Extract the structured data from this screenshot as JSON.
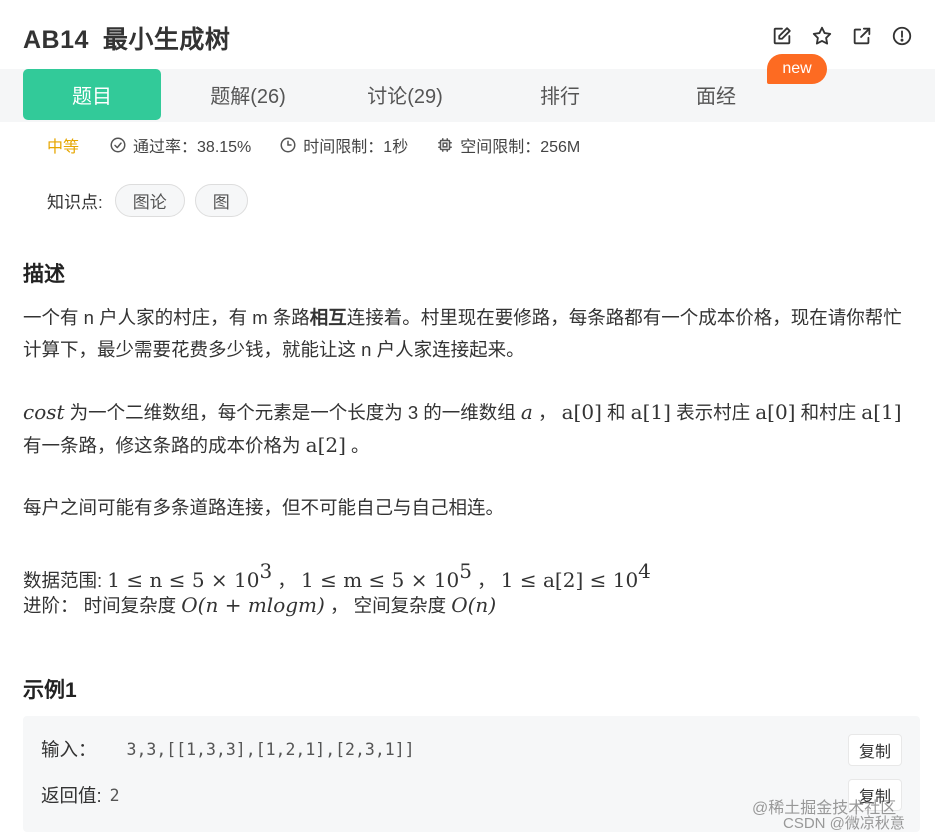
{
  "problem": {
    "code": "AB14",
    "name": "最小生成树"
  },
  "icons": [
    "edit-icon",
    "star-icon",
    "share-icon",
    "report-icon"
  ],
  "tabs": [
    {
      "label": "题目",
      "active": true
    },
    {
      "label": "题解(26)",
      "active": false
    },
    {
      "label": "讨论(29)",
      "active": false
    },
    {
      "label": "排行",
      "active": false
    },
    {
      "label": "面经",
      "active": false
    }
  ],
  "new_badge": "new",
  "meta": {
    "difficulty": "中等",
    "pass_rate": "通过率：38.15%",
    "time_limit": "时间限制：1秒",
    "memory_limit": "空间限制：256M"
  },
  "knowledge": {
    "label": "知识点:",
    "tags": [
      "图论",
      "图"
    ]
  },
  "description": {
    "heading": "描述",
    "p1_a": "一个有 n 户人家的村庄，有 m 条路",
    "p1_bold": "相互",
    "p1_b": "连接着。村里现在要修路，每条路都有一个成本价格，现在请你帮忙计算下，最少需要花费多少钱，就能让这 n 户人家连接起来。",
    "p2_cost": "cost",
    "p2_t1": " 为一个二维数组，每个元素是一个长度为 3 的一维数组 ",
    "p2_a": "a",
    "p2_t2": " ，  ",
    "p2_a0": "a[0]",
    "p2_t3": " 和 ",
    "p2_a1": "a[1]",
    "p2_t4": " 表示村庄 ",
    "p2_a0b": "a[0]",
    "p2_t5": " 和村庄 ",
    "p2_a1b": "a[1]",
    "p2_t6": " 有一条路，修这条路的成本价格为 ",
    "p2_a2": "a[2]",
    "p2_t7": " 。",
    "p3": "每户之间可能有多条道路连接，但不可能自己与自己相连。",
    "range_label": "数据范围: ",
    "range_n": "1 ≤ n ≤ 5 × 10",
    "range_n_exp": "3",
    "range_m": "1 ≤ m ≤ 5 × 10",
    "range_m_exp": "5",
    "range_a": "1 ≤ a[2] ≤ 10",
    "range_a_exp": "4",
    "sep": " ，  ",
    "adv_label": "进阶：  时间复杂度 ",
    "adv_time": "O(n + mlogm)",
    "adv_mid": " ，  空间复杂度 ",
    "adv_space": "O(n)"
  },
  "example": {
    "heading": "示例1",
    "input_label": "输入：",
    "input_value": "3,3,[[1,3,3],[1,2,1],[2,3,1]]",
    "output_label": "返回值:",
    "output_value": "2",
    "copy_label": "复制"
  },
  "watermark": {
    "line1": "@稀土掘金技术社区",
    "line2": "CSDN @微凉秋意"
  },
  "colors": {
    "accent": "#32ca99",
    "badge": "#fd6b22",
    "difficulty": "#e6a600"
  }
}
